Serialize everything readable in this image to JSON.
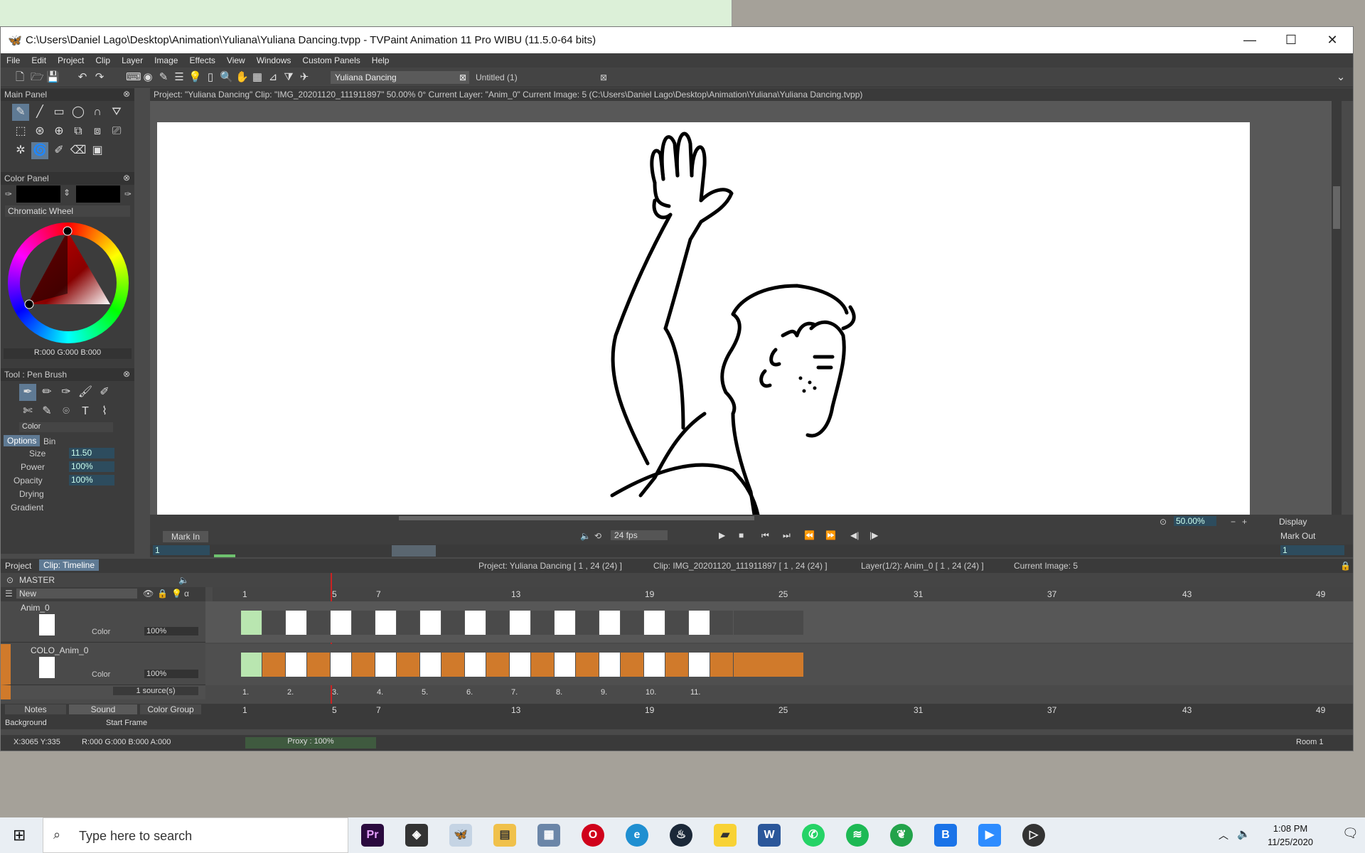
{
  "window": {
    "title": "C:\\Users\\Daniel Lago\\Desktop\\Animation\\Yuliana\\Yuliana Dancing.tvpp - TVPaint Animation 11 Pro WIBU (11.5.0-64 bits)"
  },
  "menu": [
    "File",
    "Edit",
    "Project",
    "Clip",
    "Layer",
    "Image",
    "Effects",
    "View",
    "Windows",
    "Custom Panels",
    "Help"
  ],
  "tabs": [
    {
      "label": "Yuliana Dancing"
    },
    {
      "label": "Untitled (1)"
    }
  ],
  "panels": {
    "main": "Main Panel",
    "color": "Color Panel",
    "wheel_mode": "Chromatic Wheel",
    "rgb": "R:000 G:000 B:000",
    "tool": "Tool : Pen Brush",
    "tool_mode": "Color",
    "options_tab": "Options",
    "bin_tab": "Bin",
    "size_label": "Size",
    "size_val": "11.50",
    "power_label": "Power",
    "power_val": "100%",
    "opacity_label": "Opacity",
    "opacity_val": "100%",
    "drying_label": "Drying",
    "gradient_label": "Gradient"
  },
  "canvas": {
    "info": "Project: \"Yuliana Dancing\"  Clip: \"IMG_20201120_111911897\"  50.00%  0°  Current Layer: \"Anim_0\"  Current Image: 5 (C:\\Users\\Daniel Lago\\Desktop\\Animation\\Yuliana\\Yuliana Dancing.tvpp)",
    "zoom": "50.00%",
    "display": "Display",
    "mark_in": "Mark In",
    "mark_out": "Mark Out",
    "fps": "24 fps",
    "in_val": "1",
    "out_val": "1"
  },
  "timeline": {
    "project_tab": "Project",
    "clip_tab": "Clip: Timeline",
    "project_info": "Project: Yuliana Dancing [ 1 , 24  (24) ]",
    "clip_info": "Clip: IMG_20201120_111911897 [ 1 , 24  (24) ]",
    "layer_info": "Layer(1/2): Anim_0 [ 1 , 24  (24) ]",
    "current_image": "Current Image: 5",
    "master": "MASTER",
    "new_label": "New",
    "ruler": [
      "1",
      "5",
      "7",
      "13",
      "19",
      "25",
      "31",
      "37",
      "43",
      "49"
    ],
    "layers": [
      {
        "name": "Anim_0",
        "mode": "Color",
        "opacity": "100%"
      },
      {
        "name": "COLO_Anim_0",
        "mode": "Color",
        "opacity": "100%",
        "sources": "1 source(s)"
      }
    ],
    "cell_numbers": [
      "1.",
      "2.",
      "3.",
      "4.",
      "5.",
      "6.",
      "7.",
      "8.",
      "9.",
      "10.",
      "11."
    ],
    "bottom_tabs": [
      "Notes",
      "Sound",
      "Color Group"
    ],
    "background_label": "Background",
    "start_frame_label": "Start Frame"
  },
  "status": {
    "coords": "X:3065  Y:335",
    "rgba": "R:000 G:000 B:000 A:000",
    "proxy": "Proxy : 100%",
    "room": "Room 1"
  },
  "taskbar": {
    "search_placeholder": "Type here to search",
    "time": "1:08 PM",
    "date": "11/25/2020"
  },
  "colors": {
    "accent": "#5f7a94",
    "orange": "#d07a2b",
    "green": "#6ec16e"
  }
}
